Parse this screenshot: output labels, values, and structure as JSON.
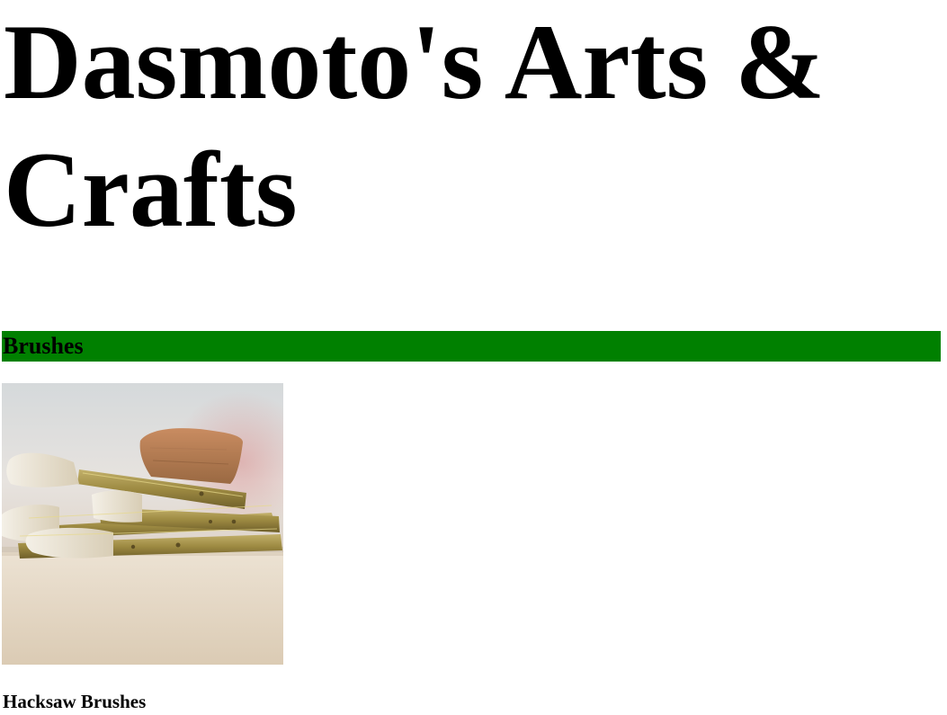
{
  "header": {
    "title": "Dasmoto's Arts & Crafts"
  },
  "sections": [
    {
      "heading": "Brushes",
      "heading_color": "#008000",
      "image": {
        "icon": "paint-brushes-photo",
        "alt": "Hacksaw Brushes"
      },
      "product_title": "Hacksaw Brushes"
    }
  ]
}
